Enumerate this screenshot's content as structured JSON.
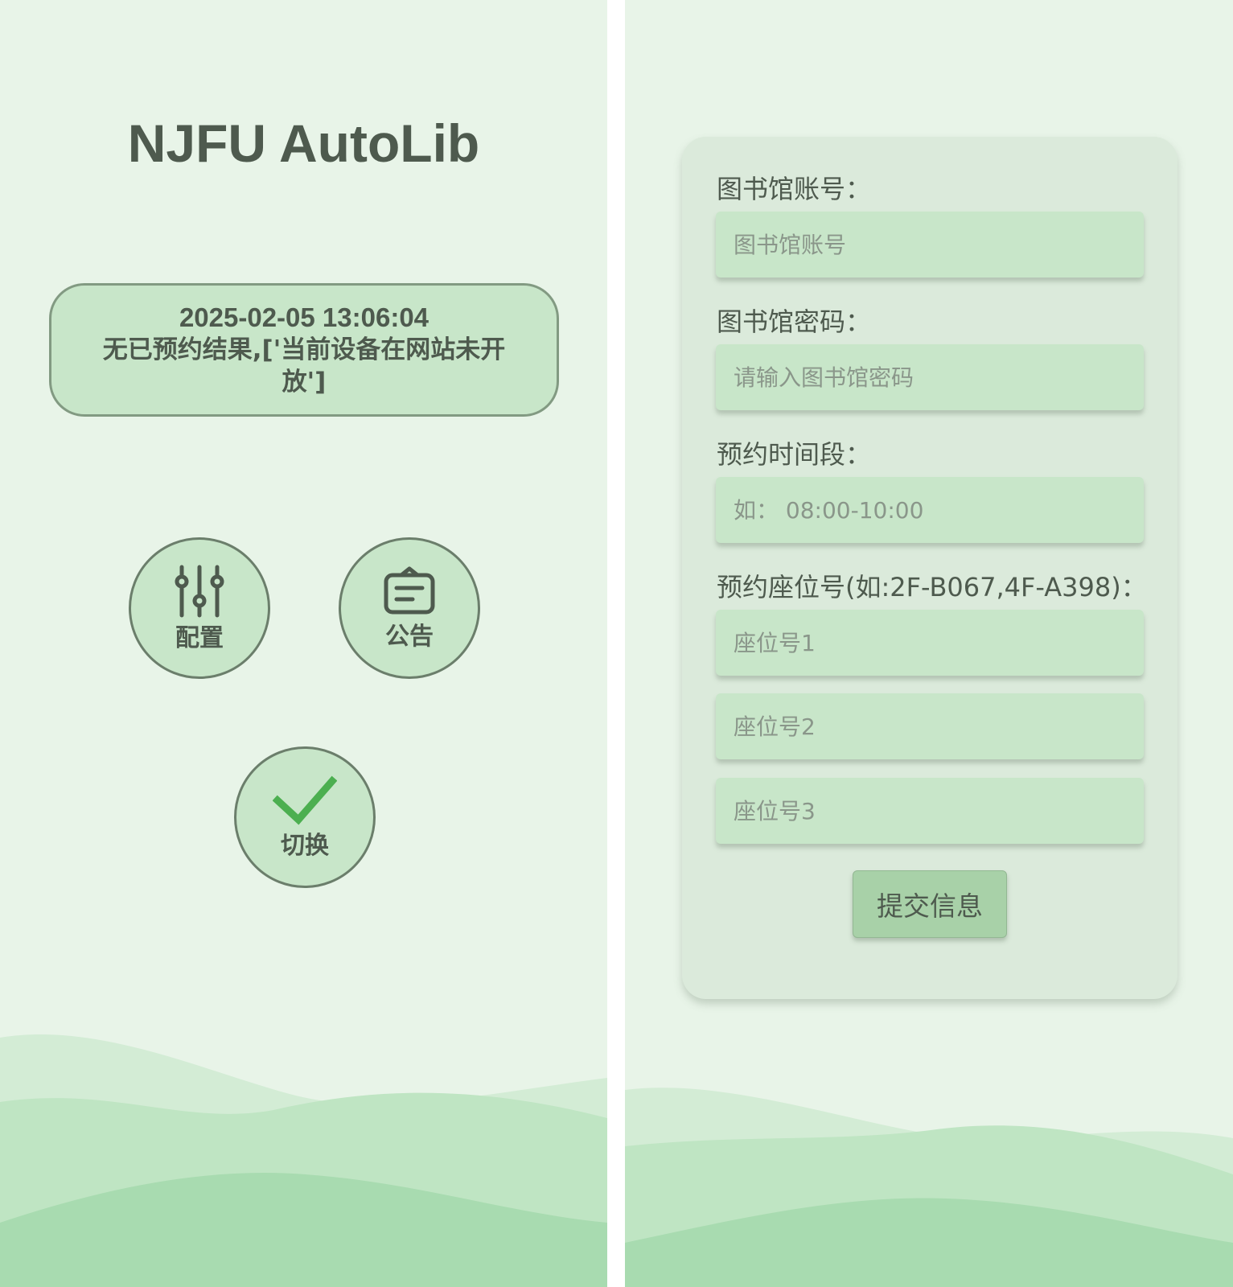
{
  "colors": {
    "background": "#e8f4e8",
    "accent_green": "#4caf50",
    "button_fill": "#c8e6c9",
    "text_dark": "#4e5a4e"
  },
  "left": {
    "title": "NJFU AutoLib",
    "status": {
      "timestamp": "2025-02-05 13:06:04",
      "message": "无已预约结果,['当前设备在网站未开放']"
    },
    "buttons": {
      "config": {
        "label": "配置",
        "icon": "sliders-icon"
      },
      "notice": {
        "label": "公告",
        "icon": "notice-board-icon"
      },
      "switch": {
        "label": "切换",
        "icon": "checkmark-icon"
      }
    }
  },
  "right": {
    "form": {
      "account_label": "图书馆账号：",
      "account_placeholder": "图书馆账号",
      "password_label": "图书馆密码：",
      "password_placeholder": "请输入图书馆密码",
      "time_label": "预约时间段：",
      "time_placeholder": "如： 08:00-10:00",
      "seat_label": "预约座位号(如:2F-B067,4F-A398)：",
      "seat1_placeholder": "座位号1",
      "seat2_placeholder": "座位号2",
      "seat3_placeholder": "座位号3",
      "submit_label": "提交信息"
    }
  }
}
